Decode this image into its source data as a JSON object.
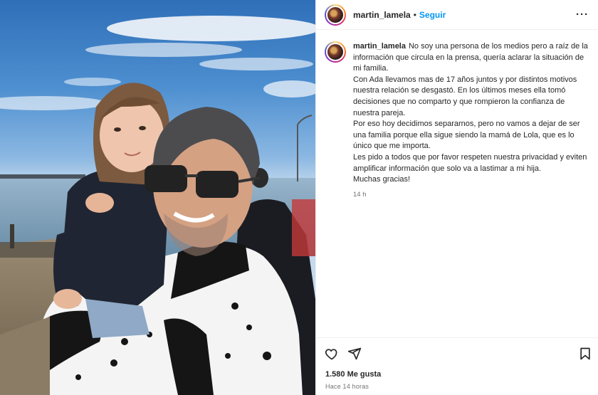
{
  "post": {
    "username": "martin_lamela",
    "separator": "•",
    "follow_label": "Seguir",
    "more_label": "···",
    "caption_lines": [
      "No soy una persona de los medios pero a raíz de la información que circula en la prensa, quería aclarar la situación de mi familia.",
      "Con Ada llevamos mas de 17 años juntos y por distintos motivos nuestra relación se desgastó. En los últimos meses ella tomó decisiones que no comparto y que rompieron la confianza de nuestra pareja.",
      "Por eso hoy decidimos separarnos, pero no vamos a dejar de ser una familia porque ella sigue siendo la mamá de Lola, que es lo único que me importa.",
      "Les pido a todos que por favor respeten nuestra privacidad y eviten amplificar información que solo va a lastimar a mi hija.",
      "Muchas gracias!"
    ],
    "comment_time": "14 h",
    "likes": "1.580 Me gusta",
    "posted_ago": "Hace 14 horas"
  },
  "icons": {
    "like": "heart-icon",
    "share": "paper-plane-icon",
    "save": "bookmark-icon"
  },
  "colors": {
    "accent": "#0095f6",
    "text": "#262626",
    "muted": "#737373",
    "border": "#efefef"
  }
}
